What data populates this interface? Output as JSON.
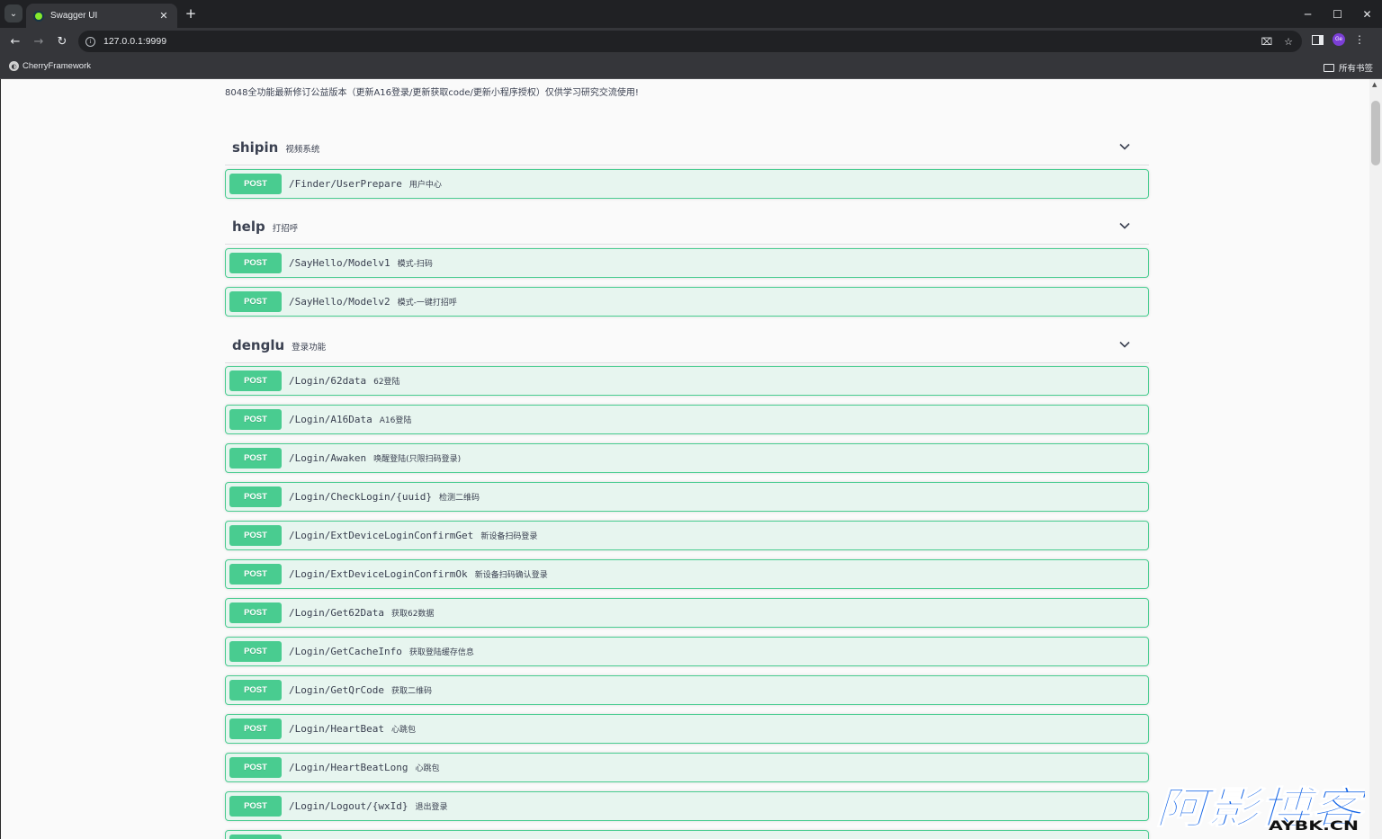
{
  "browser": {
    "tab_title": "Swagger UI",
    "url": "127.0.0.1:9999",
    "bookmark": "CherryFramework",
    "all_bookmarks": "所有书签",
    "profile_initials": "Ge"
  },
  "page": {
    "description": "8048全功能最新修订公益版本（更新A16登录/更新获取code/更新小程序授权）仅供学习研究交流使用!"
  },
  "tags": [
    {
      "name": "shipin",
      "description": "视频系统",
      "operations": [
        {
          "method": "POST",
          "path": "/Finder/UserPrepare",
          "summary": "用户中心"
        }
      ]
    },
    {
      "name": "help",
      "description": "打招呼",
      "operations": [
        {
          "method": "POST",
          "path": "/SayHello/Modelv1",
          "summary": "模式-扫码"
        },
        {
          "method": "POST",
          "path": "/SayHello/Modelv2",
          "summary": "模式-一键打招呼"
        }
      ]
    },
    {
      "name": "denglu",
      "description": "登录功能",
      "operations": [
        {
          "method": "POST",
          "path": "/Login/62data",
          "summary": "62登陆"
        },
        {
          "method": "POST",
          "path": "/Login/A16Data",
          "summary": "A16登陆"
        },
        {
          "method": "POST",
          "path": "/Login/Awaken",
          "summary": "唤醒登陆(只限扫码登录)"
        },
        {
          "method": "POST",
          "path": "/Login/CheckLogin/{uuid}",
          "summary": "检测二维码"
        },
        {
          "method": "POST",
          "path": "/Login/ExtDeviceLoginConfirmGet",
          "summary": "新设备扫码登录"
        },
        {
          "method": "POST",
          "path": "/Login/ExtDeviceLoginConfirmOk",
          "summary": "新设备扫码确认登录"
        },
        {
          "method": "POST",
          "path": "/Login/Get62Data",
          "summary": "获取62数据"
        },
        {
          "method": "POST",
          "path": "/Login/GetCacheInfo",
          "summary": "获取登陆缓存信息"
        },
        {
          "method": "POST",
          "path": "/Login/GetQrCode",
          "summary": "获取二维码"
        },
        {
          "method": "POST",
          "path": "/Login/HeartBeat",
          "summary": "心跳包"
        },
        {
          "method": "POST",
          "path": "/Login/HeartBeatLong",
          "summary": "心跳包"
        },
        {
          "method": "POST",
          "path": "/Login/Logout/{wxId}",
          "summary": "退出登录"
        }
      ]
    }
  ],
  "watermark": {
    "main": "阿影博客",
    "sub": "AYBK.CN"
  },
  "colors": {
    "post": "#49cc90",
    "text": "#3b4151",
    "watermark": "#1565e6"
  }
}
